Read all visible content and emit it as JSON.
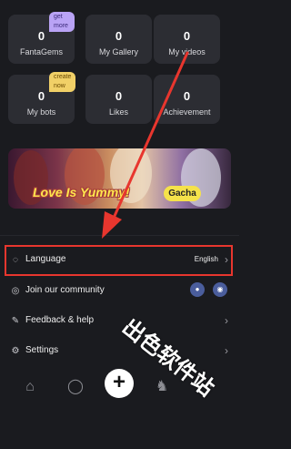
{
  "stats": [
    {
      "value": "0",
      "label": "FantaGems",
      "badge": "get more"
    },
    {
      "value": "0",
      "label": "My Gallery",
      "badge": ""
    },
    {
      "value": "0",
      "label": "My videos",
      "badge": ""
    },
    {
      "value": "0",
      "label": "My bots",
      "badge": "create now"
    },
    {
      "value": "0",
      "label": "Likes",
      "badge": ""
    },
    {
      "value": "0",
      "label": "Achievement",
      "badge": ""
    }
  ],
  "banner": {
    "title": "Love Is Yummy!",
    "button_label": "Gacha"
  },
  "menu": {
    "language": {
      "label": "Language",
      "value": "English",
      "icon": "globe-icon"
    },
    "community": {
      "label": "Join our community",
      "icon": "planet-icon",
      "social_icons": [
        "reddit-icon",
        "discord-icon"
      ]
    },
    "feedback": {
      "label": "Feedback & help",
      "icon": "edit-icon"
    },
    "settings": {
      "label": "Settings",
      "icon": "gear-icon"
    }
  },
  "bottom_nav": {
    "items": [
      "home-icon",
      "chat-icon",
      "create-icon",
      "story-icon",
      "profile-icon"
    ]
  },
  "annotation": {
    "color": "#e8362e"
  },
  "watermark": "出色软件站"
}
